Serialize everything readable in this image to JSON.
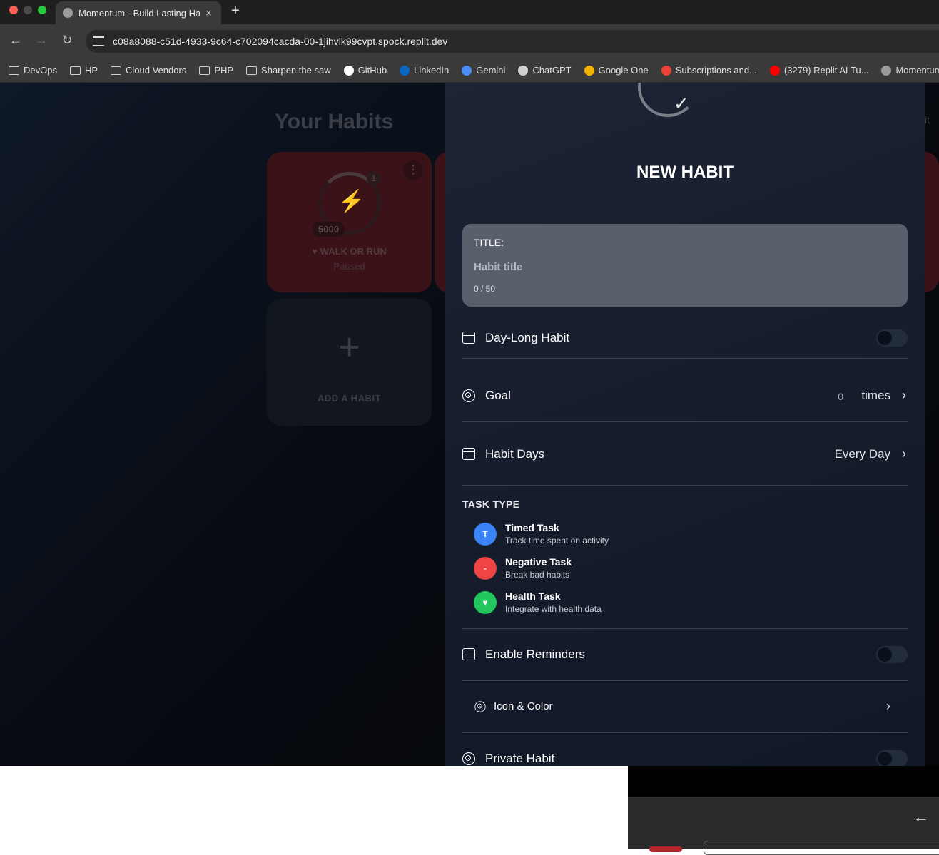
{
  "browser": {
    "tab_title": "Momentum - Build Lasting Ha",
    "tab_close": "×",
    "new_tab": "+",
    "back_icon": "←",
    "forward_icon": "→",
    "reload_icon": "↻",
    "url": "c08a8088-c51d-4933-9c64-c702094cacda-00-1jihvlk99cvpt.spock.replit.dev",
    "bookmarks": [
      {
        "label": "DevOps",
        "icon": "folder-icon"
      },
      {
        "label": "HP",
        "icon": "folder-icon"
      },
      {
        "label": "Cloud Vendors",
        "icon": "folder-icon"
      },
      {
        "label": "PHP",
        "icon": "folder-icon"
      },
      {
        "label": "Sharpen the saw",
        "icon": "folder-icon"
      },
      {
        "label": "GitHub",
        "icon": "github-icon",
        "color": "#ffffff"
      },
      {
        "label": "LinkedIn",
        "icon": "linkedin-icon",
        "color": "#0a66c2"
      },
      {
        "label": "Gemini",
        "icon": "gemini-icon",
        "color": "#4b8df8"
      },
      {
        "label": "ChatGPT",
        "icon": "chatgpt-icon",
        "color": "#cfcfcf"
      },
      {
        "label": "Google One",
        "icon": "google-one-icon",
        "color": "#f4b400"
      },
      {
        "label": "Subscriptions and...",
        "icon": "google-icon",
        "color": "#ea4335"
      },
      {
        "label": "(3279) Replit AI Tu...",
        "icon": "youtube-icon",
        "color": "#ff0000"
      },
      {
        "label": "Momentum",
        "icon": "globe-icon",
        "color": "#9a9a9a"
      }
    ]
  },
  "background": {
    "heading": "Your Habits",
    "edit_partial": "it",
    "habit_card": {
      "menu": "⋮",
      "icon": "bolt-icon",
      "bolt_glyph": "⚡",
      "badge": "1",
      "count": "5000",
      "name": "♥ WALK OR RUN",
      "status": "Paused"
    },
    "add_card": {
      "plus": "+",
      "label": "ADD A HABIT"
    }
  },
  "modal": {
    "check_glyph": "✓",
    "title": "NEW HABIT",
    "title_field": {
      "label": "TITLE:",
      "placeholder": "Habit title",
      "counter": "0 / 50"
    },
    "day_long": {
      "label": "Day-Long Habit",
      "enabled": false
    },
    "goal": {
      "label": "Goal",
      "value": "0",
      "unit": "times",
      "chevron": "›"
    },
    "habit_days": {
      "label": "Habit Days",
      "value": "Every Day",
      "chevron": "›"
    },
    "task_type": {
      "heading": "TASK TYPE",
      "options": [
        {
          "name": "Timed Task",
          "desc": "Track time spent on activity",
          "glyph": "T",
          "color": "#3b82f6"
        },
        {
          "name": "Negative Task",
          "desc": "Break bad habits",
          "glyph": "-",
          "color": "#ef4444"
        },
        {
          "name": "Health Task",
          "desc": "Integrate with health data",
          "glyph": "♥",
          "color": "#22c55e"
        }
      ]
    },
    "reminders": {
      "label": "Enable Reminders",
      "enabled": false
    },
    "icon_color": {
      "label": "Icon & Color",
      "chevron": "›"
    },
    "private": {
      "label": "Private Habit",
      "enabled": false
    }
  },
  "peek_window": {
    "back_icon": "←"
  }
}
